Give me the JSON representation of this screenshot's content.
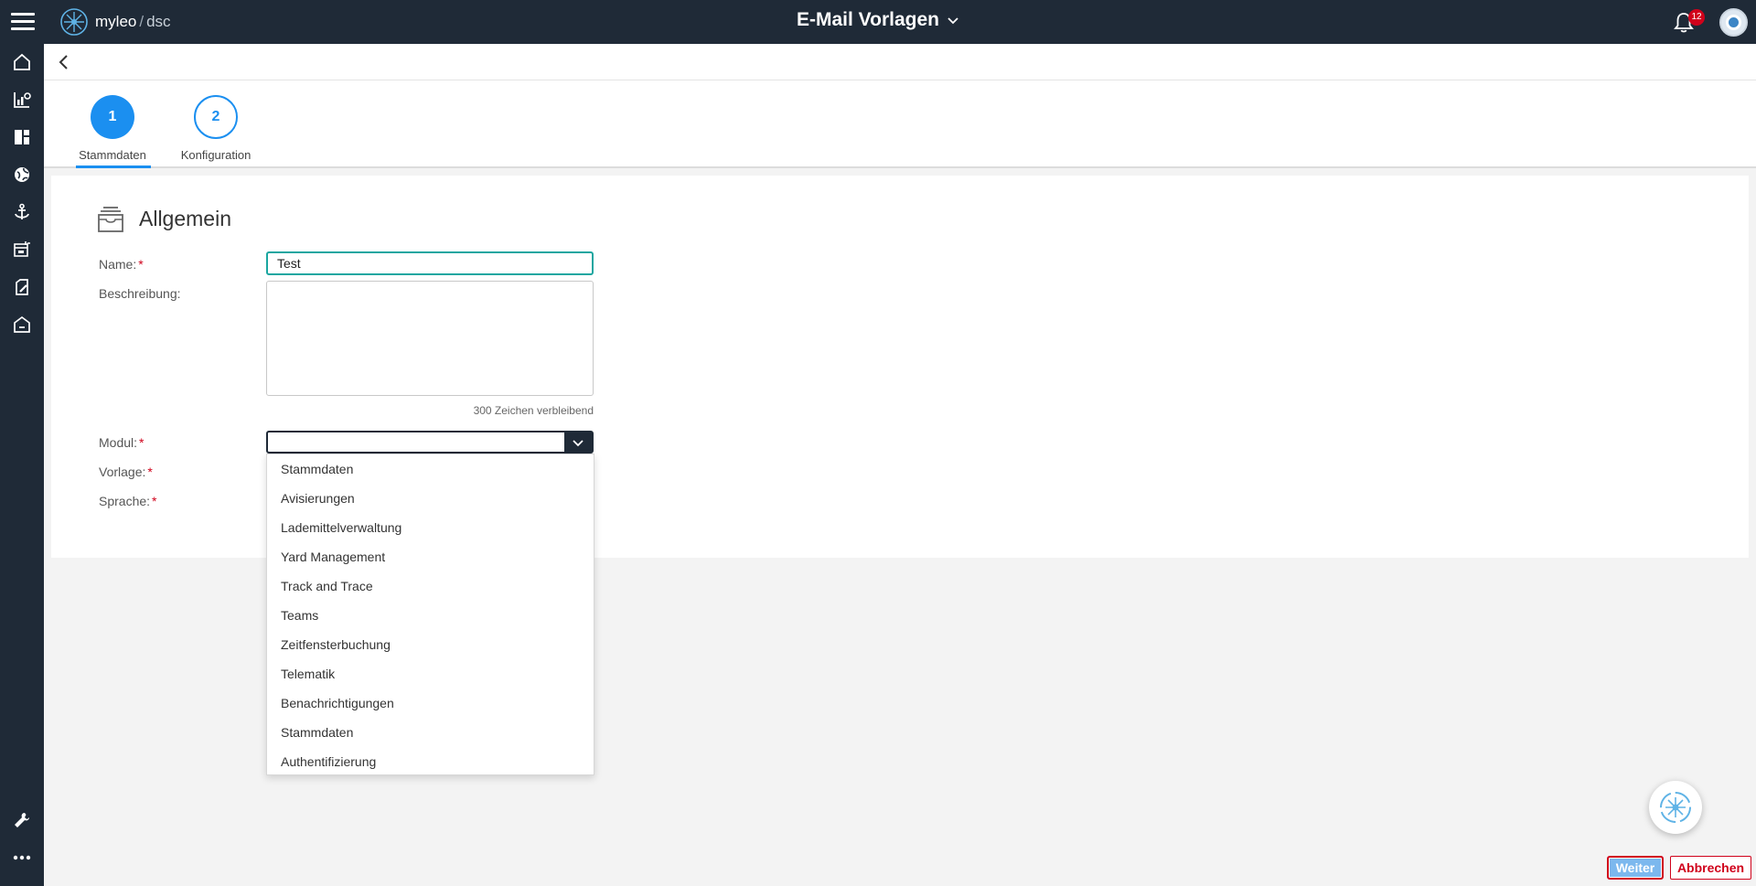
{
  "header": {
    "logo_brand": "myleo",
    "logo_sep": "/",
    "logo_sub": "dsc",
    "title": "E-Mail Vorlagen",
    "notification_count": "12"
  },
  "sidebar": {
    "items": [
      {
        "icon": "home-icon"
      },
      {
        "icon": "analytics-icon"
      },
      {
        "icon": "dashboard-icon"
      },
      {
        "icon": "globe-icon"
      },
      {
        "icon": "anchor-icon"
      },
      {
        "icon": "calendar-truck-icon"
      },
      {
        "icon": "document-edit-icon"
      },
      {
        "icon": "warehouse-icon"
      }
    ],
    "bottom_items": [
      {
        "icon": "wrench-icon"
      },
      {
        "icon": "more-icon"
      }
    ]
  },
  "stepper": {
    "steps": [
      {
        "number": "1",
        "label": "Stammdaten",
        "active": true
      },
      {
        "number": "2",
        "label": "Konfiguration",
        "active": false
      }
    ]
  },
  "form": {
    "section_title": "Allgemein",
    "name_label": "Name:",
    "name_value": "Test",
    "description_label": "Beschreibung:",
    "description_value": "",
    "char_remaining": "300 Zeichen verbleibend",
    "modul_label": "Modul:",
    "modul_value": "",
    "vorlage_label": "Vorlage:",
    "sprache_label": "Sprache:",
    "required_mark": "*"
  },
  "dropdown": {
    "options": [
      "Stammdaten",
      "Avisierungen",
      "Lademittelverwaltung",
      "Yard Management",
      "Track and Trace",
      "Teams",
      "Zeitfensterbuchung",
      "Telematik",
      "Benachrichtigungen",
      "Stammdaten",
      "Authentifizierung"
    ]
  },
  "footer": {
    "next_label": "Weiter",
    "cancel_label": "Abbrechen"
  },
  "colors": {
    "primary": "#1b8ff0",
    "nav_bg": "#1f2a37",
    "required": "#d0021b",
    "focus": "#1aa6a0"
  }
}
